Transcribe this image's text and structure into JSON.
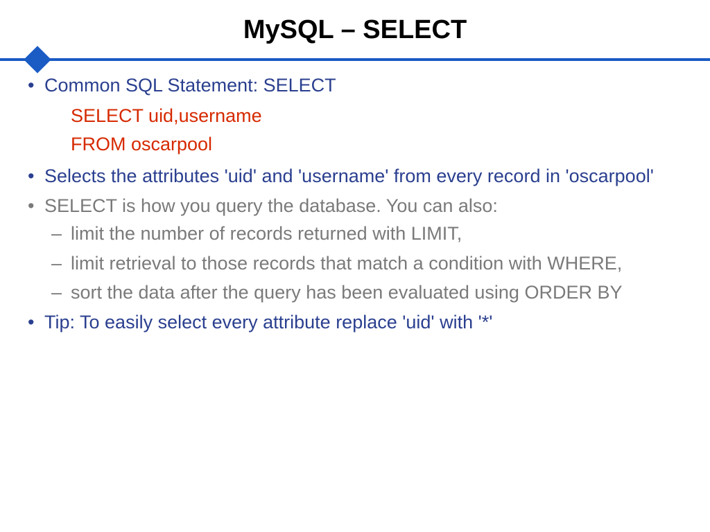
{
  "title": "MySQL – SELECT",
  "bullets": {
    "b1": "Common SQL Statement: SELECT",
    "code1": "SELECT uid,username",
    "code2": "FROM oscarpool",
    "b2": "Selects the attributes 'uid' and 'username' from every record in 'oscarpool'",
    "b3": "SELECT is how you query the database. You can also:",
    "sub1": "limit the number of records returned with LIMIT,",
    "sub2": "limit retrieval to those records that match a condition with WHERE,",
    "sub3": "sort the data after the query has been evaluated using ORDER BY",
    "b4": "Tip: To easily select every attribute replace 'uid' with '*'"
  }
}
